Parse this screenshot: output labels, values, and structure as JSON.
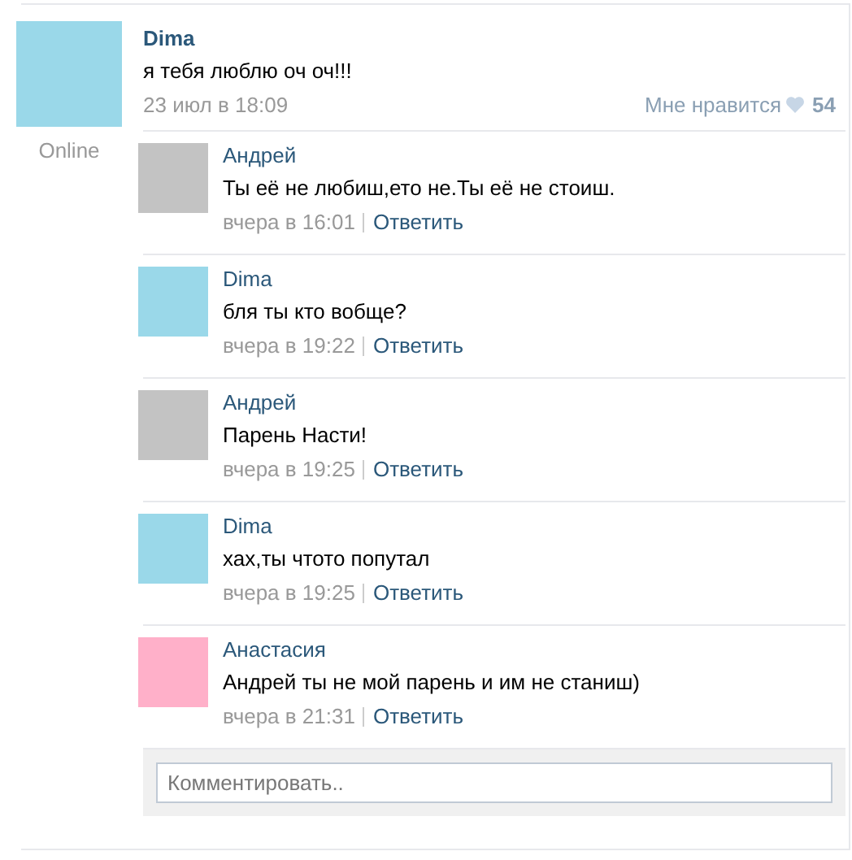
{
  "post": {
    "author": "Dima",
    "color": "#9ad8e9",
    "status": "Online",
    "text": "я тебя люблю оч оч!!!",
    "date": "23 июл в 18:09",
    "like_label": "Мне нравится",
    "like_count": "54",
    "comments": [
      {
        "author": "Андрей",
        "color": "#c3c3c3",
        "text": "Ты её не любиш,ето не.Ты её не стоиш.",
        "date": "вчера в 16:01",
        "reply": "Ответить"
      },
      {
        "author": "Dima",
        "color": "#9ad8e9",
        "text": "бля ты кто вобще?",
        "date": "вчера в 19:22",
        "reply": "Ответить"
      },
      {
        "author": "Андрей",
        "color": "#c3c3c3",
        "text": "Парень Насти!",
        "date": "вчера в 19:25",
        "reply": "Ответить"
      },
      {
        "author": "Dima",
        "color": "#9ad8e9",
        "text": "хах,ты чтото попутал",
        "date": "вчера в 19:25",
        "reply": "Ответить"
      },
      {
        "author": "Анастасия",
        "color": "#ffb0c9",
        "text": "Андрей ты не мой парень и им не станиш)",
        "date": "вчера в 21:31",
        "reply": "Ответить"
      }
    ],
    "comment_field": {
      "placeholder": "Комментировать.."
    }
  }
}
